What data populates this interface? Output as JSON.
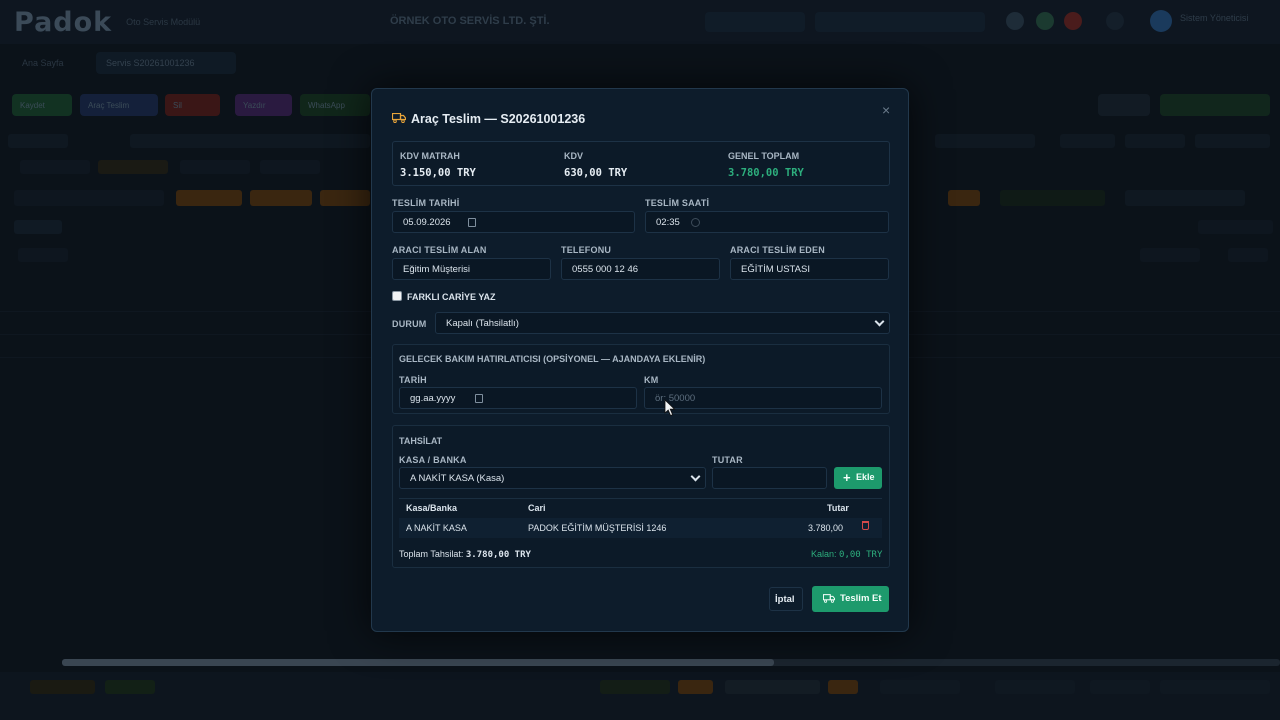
{
  "background": {
    "logo": "Padok",
    "logo_sub": "Oto Servis Modülü",
    "company": "ÖRNEK OTO SERVİS LTD. ŞTİ.",
    "user_name": "Sistem Yöneticisi",
    "tabs": [
      "Ana Sayfa",
      "Servis S20261001236"
    ],
    "actions": [
      "Kaydet",
      "Araç Teslim",
      "Sil",
      "Yazdır",
      "WhatsApp"
    ]
  },
  "modal": {
    "title": "Araç Teslim — S20261001236",
    "close": "×",
    "totals": {
      "kdv_matrah_label": "KDV MATRAH",
      "kdv_matrah_value": "3.150,00 TRY",
      "kdv_label": "KDV",
      "kdv_value": "630,00 TRY",
      "genel_toplam_label": "GENEL TOPLAM",
      "genel_toplam_value": "3.780,00 TRY"
    },
    "teslim_tarihi": {
      "label": "TESLİM TARİHİ",
      "value": "05.09.2026"
    },
    "teslim_saati": {
      "label": "TESLİM SAATİ",
      "value": "02:35"
    },
    "teslim_alan": {
      "label": "ARACI TESLİM ALAN",
      "value": "Eğitim Müşterisi"
    },
    "telefon": {
      "label": "TELEFONU",
      "value": "0555 000 12 46"
    },
    "teslim_eden": {
      "label": "ARACI TESLİM EDEN",
      "value": "EĞİTİM USTASI"
    },
    "farkli_cari": {
      "label": "FARKLI CARİYE YAZ"
    },
    "durum": {
      "label": "DURUM",
      "value": "Kapalı (Tahsilatlı)"
    },
    "bakim": {
      "title": "GELECEK BAKIM HATIRLATICISI (OPSİYONEL — AJANDAYA EKLENİR)",
      "tarih_label": "TARİH",
      "tarih_placeholder": "gg.aa.yyyy",
      "km_label": "KM",
      "km_placeholder": "ör: 50000"
    },
    "tahsilat": {
      "title": "TAHSİLAT",
      "kasa_label": "KASA / BANKA",
      "kasa_value": "A NAKİT KASA (Kasa)",
      "tutar_label": "TUTAR",
      "tutar_value": "",
      "add_button": "Ekle",
      "columns": [
        "Kasa/Banka",
        "Cari",
        "Tutar"
      ],
      "rows": [
        {
          "kasa": "A NAKİT KASA",
          "cari": "PADOK EĞİTİM MÜŞTERİSİ 1246",
          "tutar": "3.780,00"
        }
      ],
      "toplam_label": "Toplam Tahsilat:",
      "toplam_value": "3.780,00 TRY",
      "kalan_label": "Kalan:",
      "kalan_value": "0,00 TRY"
    },
    "cancel_button": "İptal",
    "deliver_button": "Teslim Et"
  },
  "colors": {
    "accent_green": "#1d9a6c",
    "total_green": "#2dae7d",
    "title_icon": "#e8a43a",
    "danger": "#d64a4a"
  }
}
